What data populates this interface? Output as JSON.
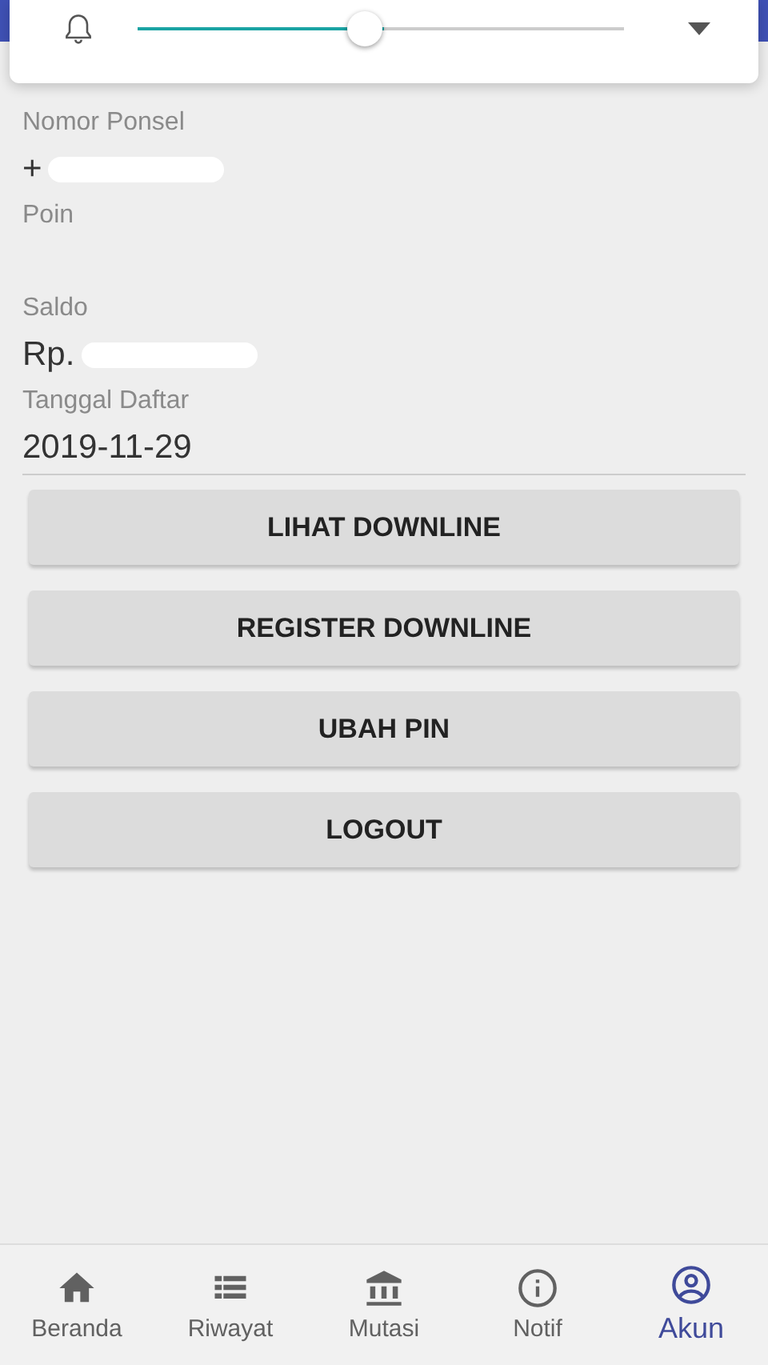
{
  "volume_panel": {
    "level": 0.47
  },
  "fields": [
    {
      "label": "Nomor Ponsel",
      "value": "+",
      "redacted": true
    },
    {
      "label": "Poin"
    },
    {
      "label": "Saldo",
      "value": "Rp.",
      "redacted": true
    },
    {
      "label": "Tanggal Daftar",
      "value": "2019-11-29",
      "redacted": false
    }
  ],
  "buttons": [
    "LIHAT DOWNLINE",
    "REGISTER DOWNLINE",
    "UBAH PIN",
    "LOGOUT"
  ],
  "nav": [
    {
      "label": "Beranda",
      "kind": "home",
      "selected": false
    },
    {
      "label": "Riwayat",
      "kind": "list",
      "selected": false
    },
    {
      "label": "Mutasi",
      "kind": "bank",
      "selected": false
    },
    {
      "label": "Notif",
      "kind": "info",
      "selected": false
    },
    {
      "label": "Akun",
      "kind": "account",
      "selected": true
    }
  ]
}
